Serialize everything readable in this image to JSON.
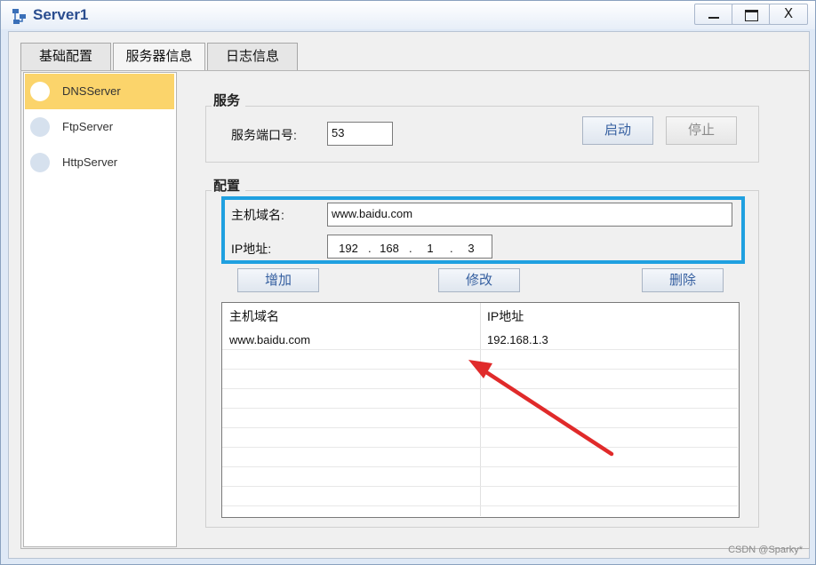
{
  "window": {
    "title": "Server1",
    "buttons": {
      "minimize": "minimize",
      "maximize": "maximize",
      "close": "X"
    }
  },
  "tabs": [
    {
      "label": "基础配置"
    },
    {
      "label": "服务器信息"
    },
    {
      "label": "日志信息"
    }
  ],
  "sidebar": {
    "items": [
      {
        "label": "DNSServer",
        "selected": true
      },
      {
        "label": "FtpServer",
        "selected": false
      },
      {
        "label": "HttpServer",
        "selected": false
      }
    ]
  },
  "service": {
    "group_title": "服务",
    "port_label": "服务端口号:",
    "port_value": "53",
    "start_label": "启动",
    "stop_label": "停止"
  },
  "config": {
    "group_title": "配置",
    "host_label": "主机域名:",
    "host_value": "www.baidu.com",
    "ip_label": "IP地址:",
    "ip_octets": [
      "192",
      "168",
      "1",
      "3"
    ],
    "ip_dot": ".",
    "add_label": "增加",
    "edit_label": "修改",
    "delete_label": "删除"
  },
  "table": {
    "columns": [
      "主机域名",
      "IP地址"
    ],
    "rows": [
      [
        "www.baidu.com",
        "192.168.1.3"
      ]
    ]
  },
  "watermark": "CSDN @Sparky*",
  "colors": {
    "highlight": "#1fa0e0",
    "arrow": "#e02a2a",
    "selected_item": "#fbd46b",
    "title": "#2a4d8f"
  }
}
